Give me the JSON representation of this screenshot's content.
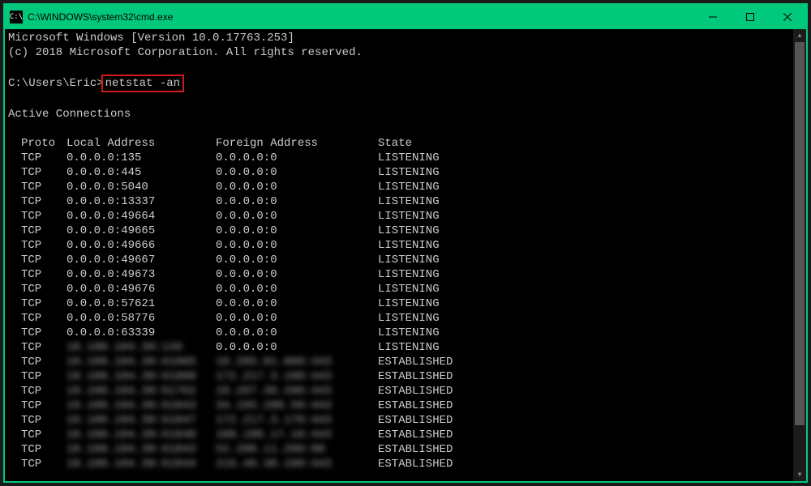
{
  "titlebar": {
    "icon_label": "C:\\",
    "title": "C:\\WINDOWS\\system32\\cmd.exe"
  },
  "banner": {
    "line1": "Microsoft Windows [Version 10.0.17763.253]",
    "line2": "(c) 2018 Microsoft Corporation. All rights reserved."
  },
  "prompt": {
    "path": "C:\\Users\\Eric>",
    "command": "netstat -an"
  },
  "section_title": "Active Connections",
  "headers": {
    "proto": "Proto",
    "local": "Local Address",
    "foreign": "Foreign Address",
    "state": "State"
  },
  "rows": [
    {
      "proto": "TCP",
      "local": "0.0.0.0:135",
      "foreign": "0.0.0.0:0",
      "state": "LISTENING",
      "blur": false
    },
    {
      "proto": "TCP",
      "local": "0.0.0.0:445",
      "foreign": "0.0.0.0:0",
      "state": "LISTENING",
      "blur": false
    },
    {
      "proto": "TCP",
      "local": "0.0.0.0:5040",
      "foreign": "0.0.0.0:0",
      "state": "LISTENING",
      "blur": false
    },
    {
      "proto": "TCP",
      "local": "0.0.0.0:13337",
      "foreign": "0.0.0.0:0",
      "state": "LISTENING",
      "blur": false
    },
    {
      "proto": "TCP",
      "local": "0.0.0.0:49664",
      "foreign": "0.0.0.0:0",
      "state": "LISTENING",
      "blur": false
    },
    {
      "proto": "TCP",
      "local": "0.0.0.0:49665",
      "foreign": "0.0.0.0:0",
      "state": "LISTENING",
      "blur": false
    },
    {
      "proto": "TCP",
      "local": "0.0.0.0:49666",
      "foreign": "0.0.0.0:0",
      "state": "LISTENING",
      "blur": false
    },
    {
      "proto": "TCP",
      "local": "0.0.0.0:49667",
      "foreign": "0.0.0.0:0",
      "state": "LISTENING",
      "blur": false
    },
    {
      "proto": "TCP",
      "local": "0.0.0.0:49673",
      "foreign": "0.0.0.0:0",
      "state": "LISTENING",
      "blur": false
    },
    {
      "proto": "TCP",
      "local": "0.0.0.0:49676",
      "foreign": "0.0.0.0:0",
      "state": "LISTENING",
      "blur": false
    },
    {
      "proto": "TCP",
      "local": "0.0.0.0:57621",
      "foreign": "0.0.0.0:0",
      "state": "LISTENING",
      "blur": false
    },
    {
      "proto": "TCP",
      "local": "0.0.0.0:58776",
      "foreign": "0.0.0.0:0",
      "state": "LISTENING",
      "blur": false
    },
    {
      "proto": "TCP",
      "local": "0.0.0.0:63339",
      "foreign": "0.0.0.0:0",
      "state": "LISTENING",
      "blur": false
    },
    {
      "proto": "TCP",
      "local": "10.100.104.30:139",
      "foreign": "0.0.0.0:0",
      "state": "LISTENING",
      "blur_local": true
    },
    {
      "proto": "TCP",
      "local": "10.100.104.30:61005",
      "foreign": "10.205.01.000:443",
      "state": "ESTABLISHED",
      "blur_local": true,
      "blur_foreign": true
    },
    {
      "proto": "TCP",
      "local": "10.100.104.30:61000",
      "foreign": "172.217.3.100:443",
      "state": "ESTABLISHED",
      "blur_local": true,
      "blur_foreign": true
    },
    {
      "proto": "TCP",
      "local": "10.100.104.30:61762",
      "foreign": "10.207.30.200:443",
      "state": "ESTABLISHED",
      "blur_local": true,
      "blur_foreign": true
    },
    {
      "proto": "TCP",
      "local": "10.100.104.30:61043",
      "foreign": "34.195.200.50:443",
      "state": "ESTABLISHED",
      "blur_local": true,
      "blur_foreign": true
    },
    {
      "proto": "TCP",
      "local": "10.100.104.30:61047",
      "foreign": "172.217.3.170:443",
      "state": "ESTABLISHED",
      "blur_local": true,
      "blur_foreign": true
    },
    {
      "proto": "TCP",
      "local": "10.100.104.30:61048",
      "foreign": "100.100.17.10:443",
      "state": "ESTABLISHED",
      "blur_local": true,
      "blur_foreign": true
    },
    {
      "proto": "TCP",
      "local": "10.100.104.30:61043",
      "foreign": "52.200.11.200:80",
      "state": "ESTABLISHED",
      "blur_local": true,
      "blur_foreign": true
    },
    {
      "proto": "TCP",
      "local": "10.100.104.30:61044",
      "foreign": "216.48.30.100:443",
      "state": "ESTABLISHED",
      "blur_local": true,
      "blur_foreign": true
    }
  ]
}
